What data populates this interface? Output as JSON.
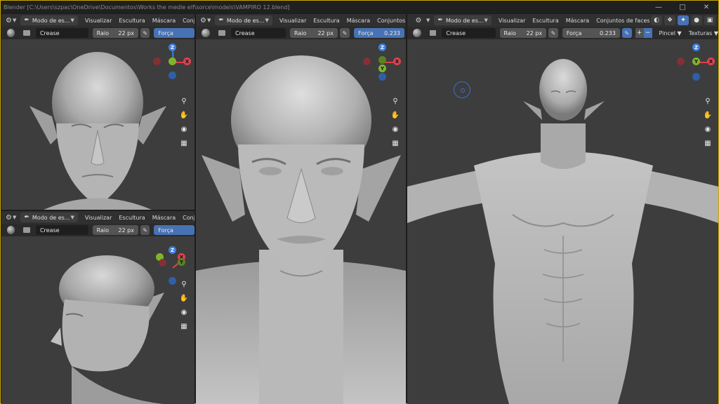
{
  "window": {
    "title": "Blender [C:\\Users\\szpac\\OneDrive\\Documentos\\Works the medle elf\\sorce\\models\\VAMPIRO 12.blend]",
    "controls": [
      "minimize-icon",
      "maximize-icon",
      "close-icon"
    ]
  },
  "editors": [
    {
      "id": "top-left",
      "header": {
        "mode_label": "Modo de es...",
        "menus": [
          "Visualizar",
          "Escultura",
          "Máscara",
          "Conjuntos de"
        ]
      },
      "tool": {
        "brush": "Crease",
        "radius_label": "Raio",
        "radius_value": "22 px",
        "strength_label": "Força",
        "strength_value": ""
      }
    },
    {
      "id": "bottom-left",
      "header": {
        "mode_label": "Modo de es...",
        "menus": [
          "Visualizar",
          "Escultura",
          "Máscara",
          "Conjuntos de"
        ]
      },
      "tool": {
        "brush": "Crease",
        "radius_label": "Raio",
        "radius_value": "22 px",
        "strength_label": "Força",
        "strength_value": ""
      }
    },
    {
      "id": "middle",
      "header": {
        "mode_label": "Modo de es...",
        "menus": [
          "Visualizar",
          "Escultura",
          "Máscara",
          "Conjuntos de faces"
        ]
      },
      "tool": {
        "brush": "Crease",
        "radius_label": "Raio",
        "radius_value": "22 px",
        "strength_label": "Força",
        "strength_value": "0.233"
      }
    },
    {
      "id": "right",
      "header": {
        "mode_label": "Modo de es...",
        "menus": [
          "Visualizar",
          "Escultura",
          "Máscara",
          "Conjuntos de faces"
        ]
      },
      "tool": {
        "brush": "Crease",
        "radius_label": "Raio",
        "radius_value": "22 px",
        "strength_label": "Força",
        "strength_value": "0.233",
        "brush_menu": "Pincel",
        "texture_menu": "Texturas"
      }
    }
  ],
  "gizmo": {
    "z_label": "Z",
    "x_label": "X",
    "y_label": "Y"
  },
  "nav_icons": [
    "zoom-icon",
    "hand-pan-icon",
    "camera-icon",
    "grid-view-icon"
  ],
  "colors": {
    "accent": "#4772b3",
    "axis_x": "#e0404f",
    "axis_y": "#7fb52c",
    "axis_z": "#3f7fe0",
    "window_border": "#c9a800"
  }
}
